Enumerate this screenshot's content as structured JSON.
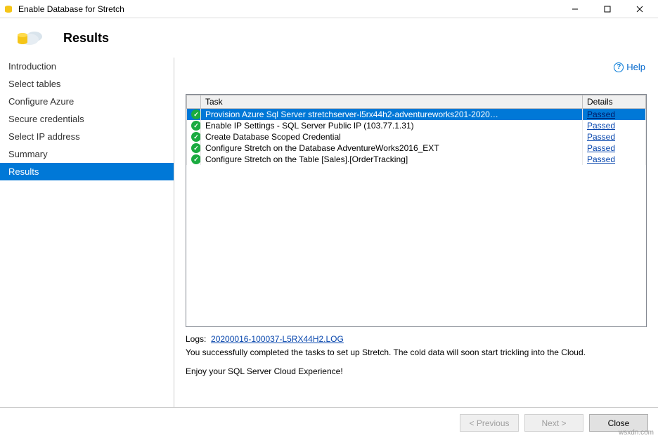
{
  "window": {
    "title": "Enable Database for Stretch"
  },
  "header": {
    "title": "Results"
  },
  "help": {
    "label": "Help"
  },
  "sidebar": {
    "items": [
      {
        "label": "Introduction"
      },
      {
        "label": "Select tables"
      },
      {
        "label": "Configure Azure"
      },
      {
        "label": "Secure credentials"
      },
      {
        "label": "Select IP address"
      },
      {
        "label": "Summary"
      },
      {
        "label": "Results"
      }
    ],
    "selected_index": 6
  },
  "results": {
    "columns": {
      "icon": "",
      "task": "Task",
      "details": "Details"
    },
    "rows": [
      {
        "task": "Provision Azure Sql Server stretchserver-l5rx44h2-adventureworks201-2020…",
        "details": "Passed",
        "selected": true
      },
      {
        "task": "Enable IP Settings - SQL Server Public IP (103.77.1.31)",
        "details": "Passed",
        "selected": false
      },
      {
        "task": "Create Database Scoped Credential",
        "details": "Passed",
        "selected": false
      },
      {
        "task": "Configure Stretch on the Database AdventureWorks2016_EXT",
        "details": "Passed",
        "selected": false
      },
      {
        "task": "Configure Stretch on the Table [Sales].[OrderTracking]",
        "details": "Passed",
        "selected": false
      }
    ]
  },
  "logs": {
    "label": "Logs:",
    "link": "20200016-100037-L5RX44H2.LOG"
  },
  "messages": {
    "line1": "You successfully completed the tasks to set up Stretch. The cold data will soon start trickling into the Cloud.",
    "line2": "Enjoy your SQL Server Cloud Experience!"
  },
  "footer": {
    "previous": "< Previous",
    "next": "Next >",
    "close": "Close"
  },
  "watermark": "wsxdn.com"
}
